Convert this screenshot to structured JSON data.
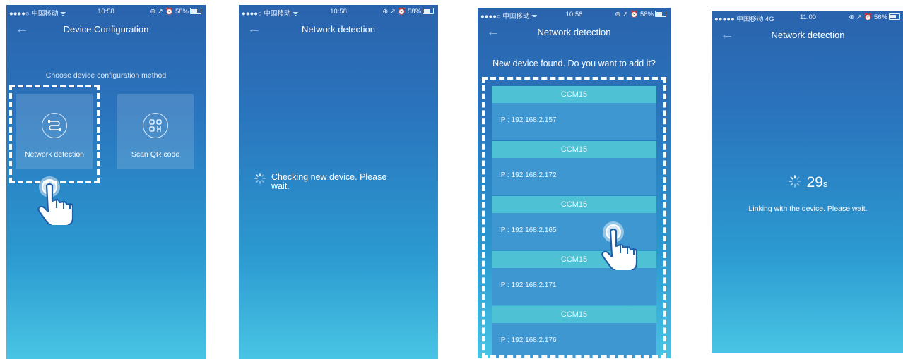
{
  "status_bars": [
    {
      "left": "●●●●○ 中国移动 ᯤ",
      "time": "10:58",
      "right": "⊕ ↗ ⏰ 58%"
    },
    {
      "left": "●●●●○ 中国移动 ᯤ",
      "time": "10:58",
      "right": "⊕ ↗ ⏰ 58%"
    },
    {
      "left": "●●●●○ 中国移动 ᯤ",
      "time": "10:58",
      "right": "⊕ ↗ ⏰ 58%"
    },
    {
      "left": "●●●●● 中国移动 4G",
      "time": "11:00",
      "right": "⊕ ↗ ⏰ 56%"
    }
  ],
  "screen1": {
    "title": "Device Configuration",
    "subtitle": "Choose device configuration method",
    "option_network": "Network detection",
    "option_qr": "Scan QR code"
  },
  "screen2": {
    "title": "Network detection",
    "message": "Checking new device. Please wait."
  },
  "screen3": {
    "title": "Network detection",
    "message": "New device found. Do you want to add it?",
    "devices": [
      {
        "name": "CCM15",
        "ip": "IP : 192.168.2.157"
      },
      {
        "name": "CCM15",
        "ip": "IP : 192.168.2.172"
      },
      {
        "name": "CCM15",
        "ip": "IP : 192.168.2.165"
      },
      {
        "name": "CCM15",
        "ip": "IP : 192.168.2.171"
      },
      {
        "name": "CCM15",
        "ip": "IP : 192.168.2.176"
      }
    ]
  },
  "screen4": {
    "title": "Network detection",
    "countdown": "29",
    "countdown_unit": "s",
    "message": "Linking with the device. Please wait."
  },
  "icons": {
    "back": "arrow-left-icon",
    "network": "network-cable-icon",
    "qr": "qr-code-icon",
    "spinner": "loading-spinner-icon",
    "hand": "pointing-hand-icon"
  },
  "colors": {
    "bg_top": "#2a63ad",
    "bg_bottom": "#48c4e4",
    "device_header": "#4ec2d4",
    "device_row": "#3f97d2",
    "highlight": "#ffffff"
  }
}
